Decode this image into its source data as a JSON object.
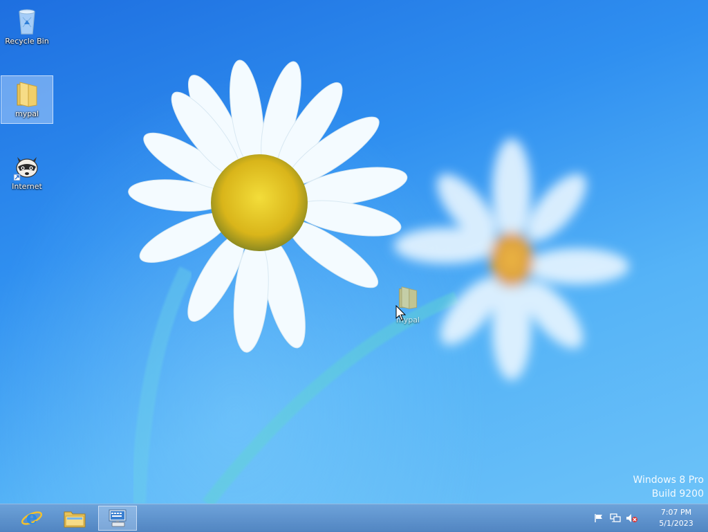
{
  "desktop": {
    "icons": [
      {
        "label": "Recycle Bin",
        "icon": "recycle-bin-icon"
      },
      {
        "label": "mypal",
        "icon": "folder-icon",
        "selected": true
      },
      {
        "label": "Internet",
        "icon": "raccoon-shortcut-icon"
      }
    ],
    "drag_ghost": {
      "label": "mypal",
      "icon": "folder-icon"
    }
  },
  "watermark": {
    "line1": "Windows 8 Pro",
    "line2": "Build 9200"
  },
  "taskbar": {
    "buttons": [
      {
        "name": "internet-explorer",
        "icon": "ie-icon"
      },
      {
        "name": "file-explorer",
        "icon": "folder-icon"
      },
      {
        "name": "on-screen-keyboard",
        "icon": "keyboard-icon",
        "active": true
      }
    ],
    "tray": {
      "icons": [
        "action-center-flag-icon",
        "network-icon",
        "volume-muted-icon"
      ],
      "time": "7:07 PM",
      "date": "5/1/2023"
    }
  },
  "colors": {
    "accent": "#2f8ff0",
    "taskbar": "#5f8fc8"
  }
}
